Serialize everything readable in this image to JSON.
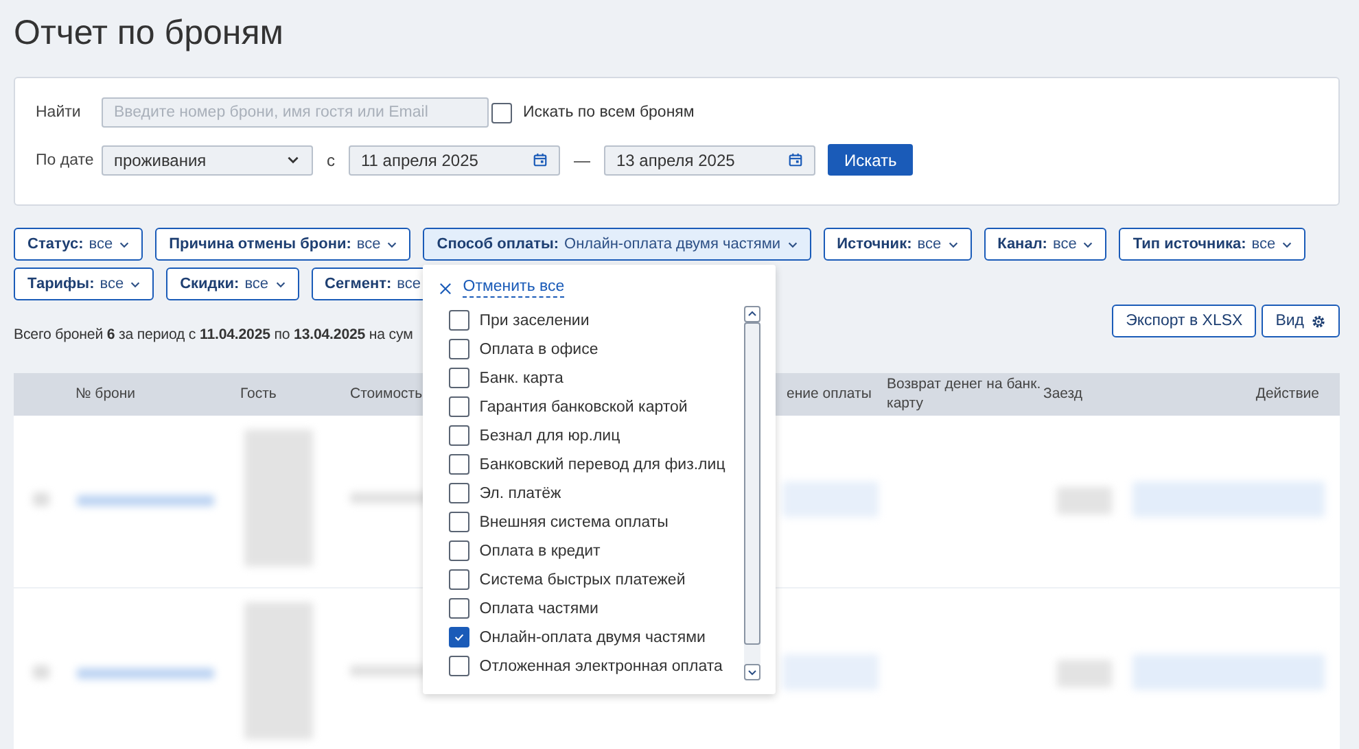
{
  "title": "Отчет по броням",
  "search": {
    "label": "Найти",
    "placeholder": "Введите номер брони, имя гостя или Email",
    "all_label": "Искать по всем броням",
    "all_checked": false
  },
  "date": {
    "label": "По дате",
    "select_value": "проживания",
    "from_label": "с",
    "from": "11 апреля 2025",
    "dash": "—",
    "to": "13 апреля 2025",
    "button": "Искать"
  },
  "filters": [
    {
      "label": "Статус:",
      "value": "все",
      "expanded": false
    },
    {
      "label": "Причина отмены брони:",
      "value": "все",
      "expanded": false
    },
    {
      "label": "Способ оплаты:",
      "value": "Онлайн-оплата двумя частями",
      "expanded": true
    },
    {
      "label": "Источник:",
      "value": "все",
      "expanded": false
    },
    {
      "label": "Канал:",
      "value": "все",
      "expanded": false
    },
    {
      "label": "Тип источника:",
      "value": "все",
      "expanded": false
    },
    {
      "label": "Тарифы:",
      "value": "все",
      "expanded": false
    },
    {
      "label": "Скидки:",
      "value": "все",
      "expanded": false
    },
    {
      "label": "Сегмент:",
      "value": "все",
      "expanded": false
    }
  ],
  "dropdown": {
    "clear": "Отменить все",
    "options": [
      {
        "label": "При заселении",
        "checked": false
      },
      {
        "label": "Оплата в офисе",
        "checked": false
      },
      {
        "label": "Банк. карта",
        "checked": false
      },
      {
        "label": "Гарантия банковской картой",
        "checked": false
      },
      {
        "label": "Безнал для юр.лиц",
        "checked": false
      },
      {
        "label": "Банковский перевод для физ.лиц",
        "checked": false
      },
      {
        "label": "Эл. платёж",
        "checked": false
      },
      {
        "label": "Внешняя система оплаты",
        "checked": false
      },
      {
        "label": "Оплата в кредит",
        "checked": false
      },
      {
        "label": "Система быстрых платежей",
        "checked": false
      },
      {
        "label": "Оплата частями",
        "checked": false
      },
      {
        "label": "Онлайн-оплата двумя частями",
        "checked": true
      },
      {
        "label": "Отложенная электронная оплата",
        "checked": false
      }
    ]
  },
  "summary": "Всего броней **6** за период с **11.04.2025** по **13.04.2025** на сум",
  "export_button": "Экспорт в XLSX",
  "view_button": "Вид",
  "table": {
    "columns": [
      "№ брони",
      "Гость",
      "Стоимость",
      "ение оплаты",
      "Возврат денег на банк. карту",
      "Заезд",
      "Действие"
    ]
  }
}
